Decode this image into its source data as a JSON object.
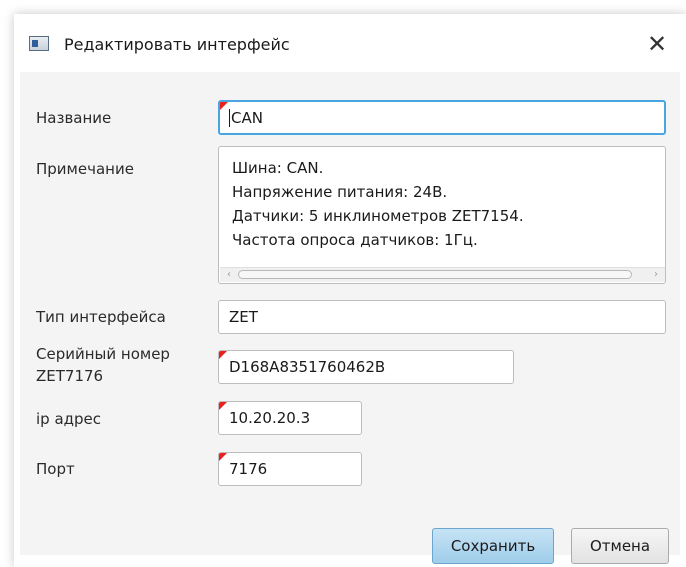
{
  "window": {
    "title": "Редактировать интерфейс",
    "app_icon": "window-icon",
    "close_glyph": "✕"
  },
  "form": {
    "name": {
      "label": "Название",
      "value": "CAN",
      "required": true
    },
    "note": {
      "label": "Примечание",
      "lines": [
        "Шина: CAN.",
        "Напряжение питания: 24В.",
        "Датчики: 5 инклинометров ZET7154.",
        "Частота опроса датчиков: 1Гц."
      ]
    },
    "interface_type": {
      "label": "Тип интерфейса",
      "value": "ZET"
    },
    "serial": {
      "label_line1": "Серийный номер",
      "label_line2": "ZET7176",
      "value": "D168A8351760462B",
      "required": true
    },
    "ip": {
      "label": "ip адрес",
      "value": "10.20.20.3",
      "required": true
    },
    "port": {
      "label": "Порт",
      "value": "7176",
      "required": true
    }
  },
  "buttons": {
    "save": "Сохранить",
    "cancel": "Отмена"
  },
  "colors": {
    "required_marker": "#e8211c",
    "focus_border": "#49a5e0",
    "primary_button": "#b3d9f1"
  }
}
